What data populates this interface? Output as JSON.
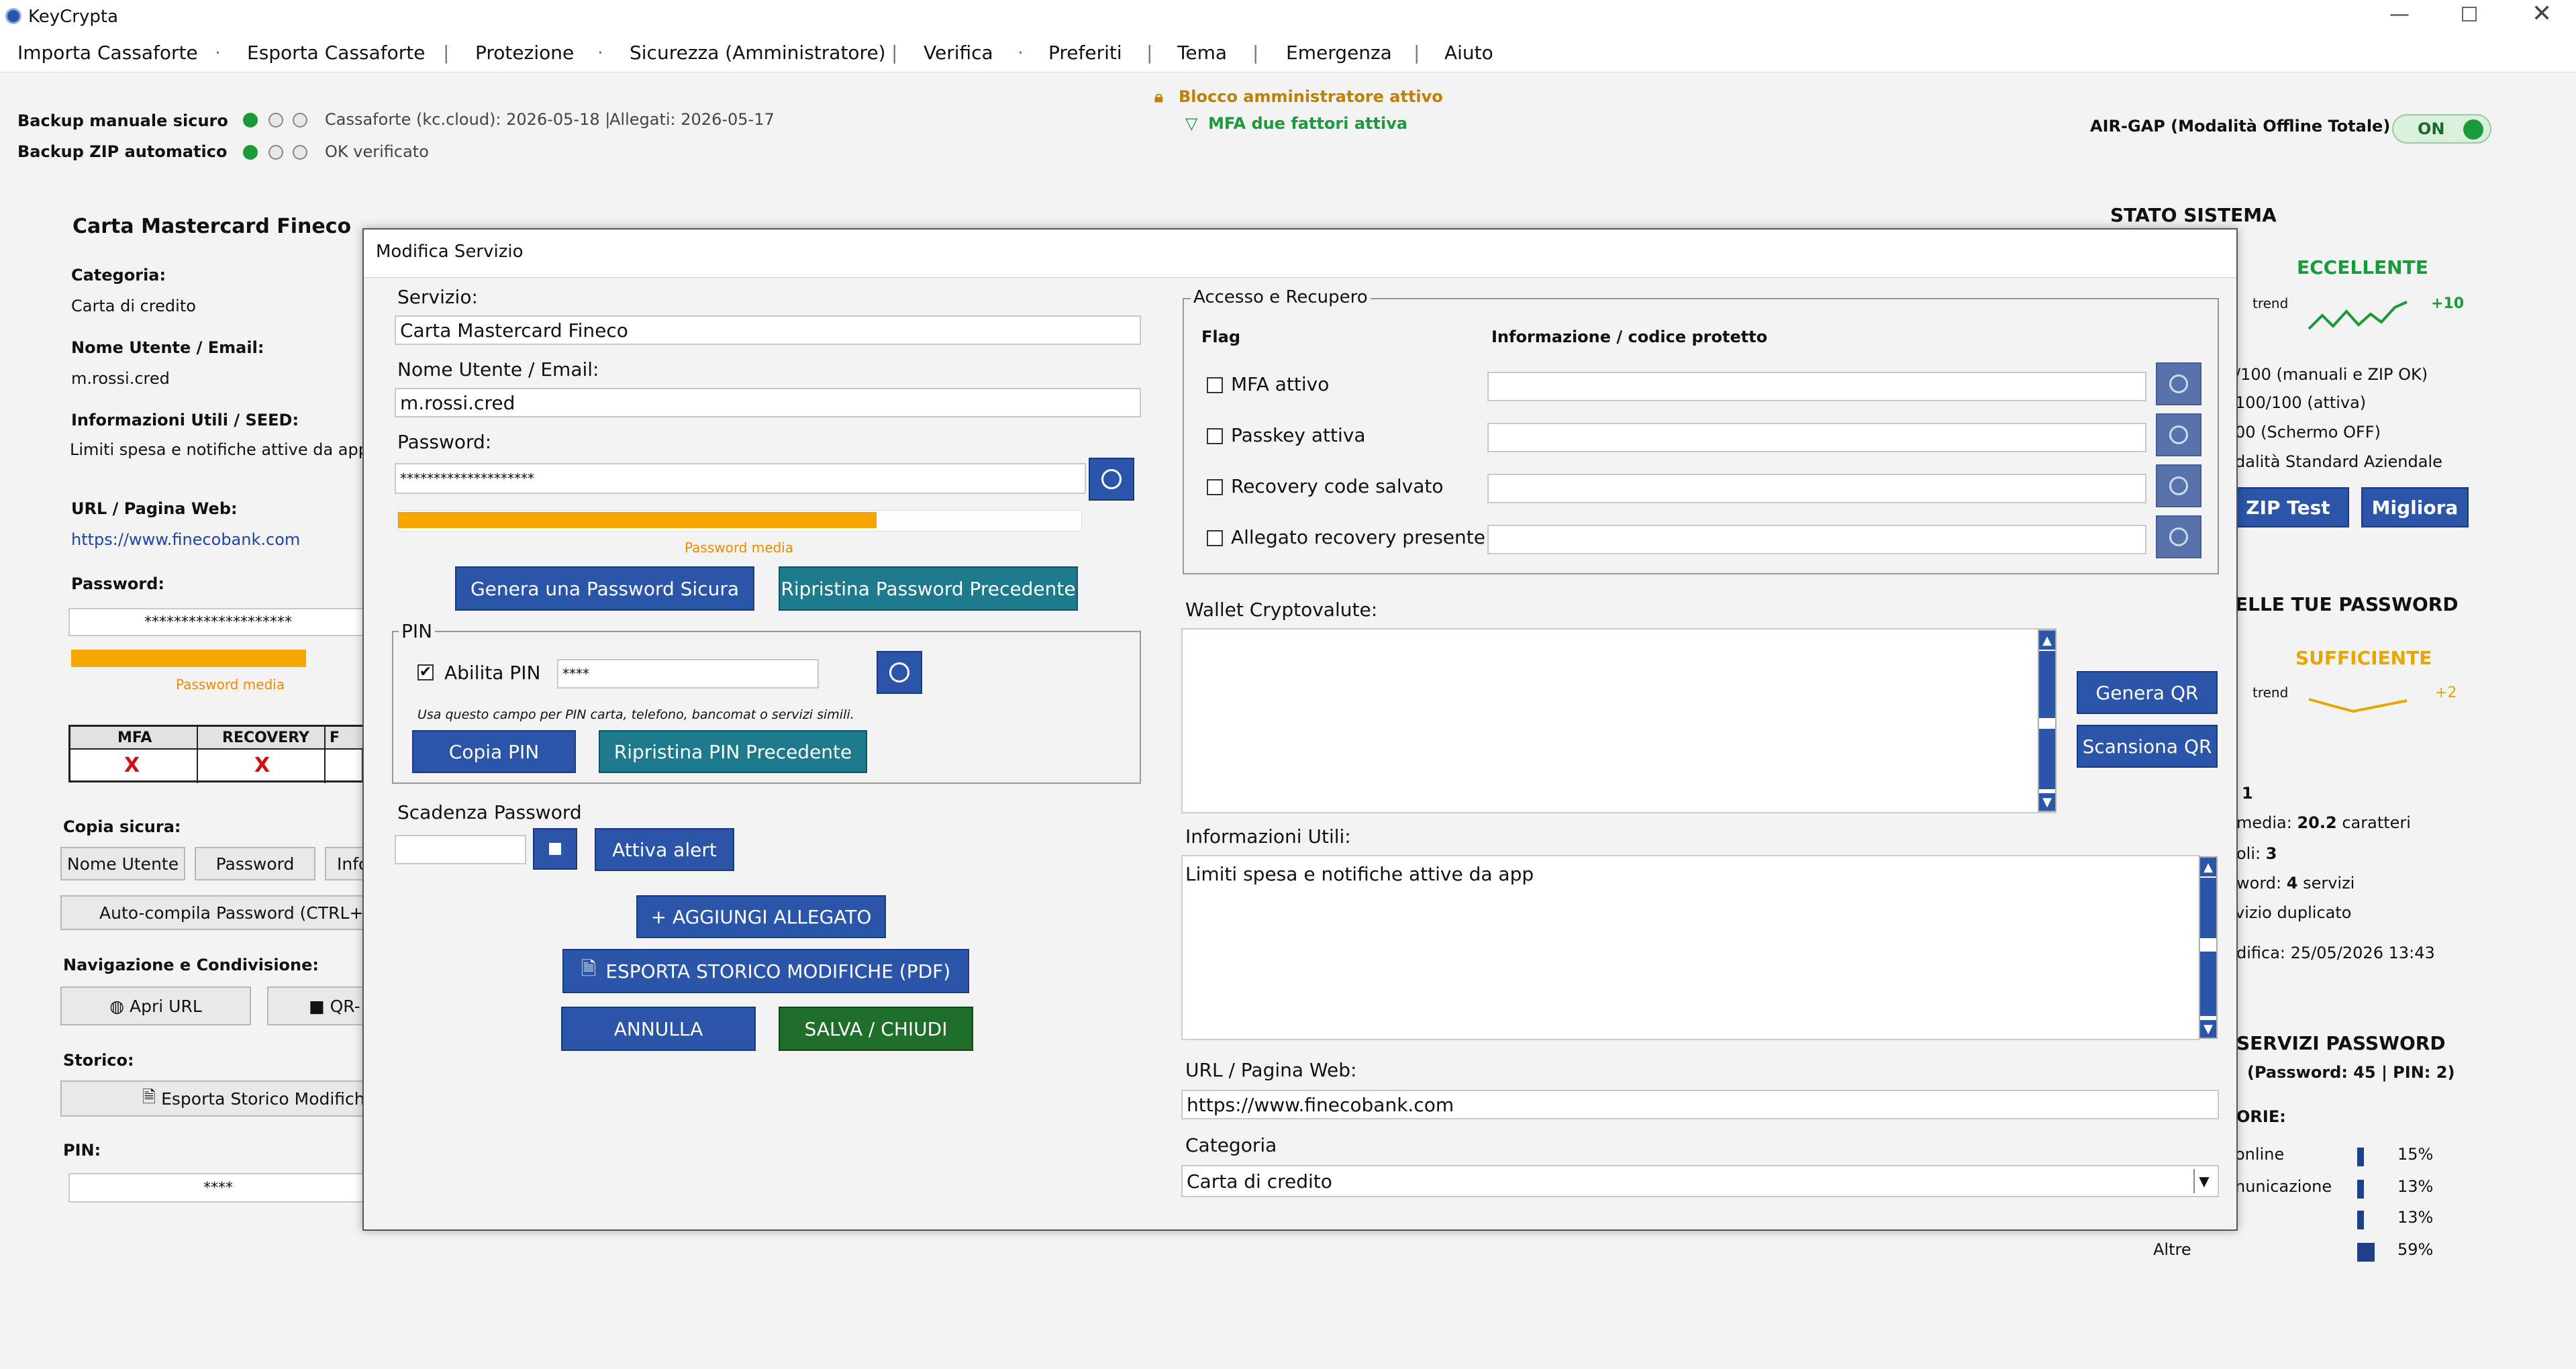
{
  "window": {
    "title": "KeyCrypta"
  },
  "menu": [
    "Importa Cassaforte",
    "Esporta Cassaforte",
    "Protezione",
    "Sicurezza (Amministratore)",
    "Verifica",
    "Preferiti",
    "Tema",
    "Emergenza",
    "Aiuto"
  ],
  "status": {
    "backup_manual_label": "Backup manuale sicuro",
    "backup_manual_info": "Cassaforte (kc.cloud): 2026-05-18 |",
    "backup_manual_attach": "Allegati: 2026-05-17",
    "backup_zip_label": "Backup ZIP automatico",
    "backup_zip_info": "OK verificato",
    "admin_lock": "Blocco amministratore attivo",
    "mfa_active": "MFA due fattori attiva",
    "airgap_label": "AIR-GAP (Modalità Offline Totale)",
    "airgap_toggle": "ON",
    "colors": {
      "green": "#1a9a3a",
      "orange": "#c08000",
      "accent": "#2b55a8"
    }
  },
  "left_panel": {
    "title": "Carta Mastercard Fineco",
    "category_label": "Categoria:",
    "category_value": "Carta di credito",
    "user_label": "Nome Utente / Email:",
    "user_value": "m.rossi.cred",
    "info_label": "Informazioni Utili / SEED:",
    "info_value": "Limiti spesa e notifiche attive da app",
    "url_label": "URL / Pagina Web:",
    "url_value": "https://www.finecobank.com",
    "password_label": "Password:",
    "password_value": "********************",
    "strength_text": "Password media",
    "flags_headers": [
      "MFA",
      "RECOVERY",
      "F"
    ],
    "flags_values": [
      "X",
      "X",
      ""
    ],
    "copy_label": "Copia sicura:",
    "copy_buttons": [
      "Nome Utente",
      "Password",
      "Info"
    ],
    "autofill": "Auto-compila Password (CTRL+A",
    "nav_label": "Navigazione e Condivisione:",
    "open_url": "Apri URL",
    "qr": "QR-",
    "history_label": "Storico:",
    "export_history": "Esporta Storico Modifich",
    "pin_label": "PIN:",
    "pin_value": "****"
  },
  "right_panel": {
    "title": "STATO SISTEMA",
    "rating": "ECCELLENTE",
    "trend_label": "trend",
    "trend_delta": "+10",
    "lines": [
      "/100 (manuali e ZIP OK)",
      "100/100 (attiva)",
      "00 (Schermo OFF)",
      "dalità Standard Aziendale"
    ],
    "zip_test": "ZIP Test",
    "improve": "Migliora",
    "pw_title": "ELLE TUE PASSWORD",
    "pw_rating": "SUFFICIENTE",
    "pw_trend": "trend",
    "pw_delta": "+2",
    "stat_1": "1",
    "stat_avg_prefix": "media:",
    "stat_avg_value": "20.2",
    "stat_avg_suffix": "caratteri",
    "stat_soli_prefix": "oli:",
    "stat_soli_value": "3",
    "stat_word_prefix": "word:",
    "stat_word_value": "4",
    "stat_word_suffix": "servizi",
    "stat_dup": "vizio duplicato",
    "stat_mod": "difica: 25/05/2026 13:43",
    "services_title": "SERVIZI PASSWORD",
    "services_sub": "(Password: 45 | PIN: 2)",
    "cat_title": "ORIE:",
    "categories": [
      {
        "label": "online",
        "pct": "15%",
        "value": 15
      },
      {
        "label": "nunicazione",
        "pct": "13%",
        "value": 13
      },
      {
        "label": "",
        "pct": "13%",
        "value": 13
      },
      {
        "label": "Altre",
        "pct": "59%",
        "value": 59
      }
    ]
  },
  "dialog": {
    "title": "Modifica Servizio",
    "service_label": "Servizio:",
    "service_value": "Carta Mastercard Fineco",
    "user_label": "Nome Utente / Email:",
    "user_value": "m.rossi.cred",
    "password_label": "Password:",
    "password_value": "********************",
    "strength_text": "Password media",
    "strength": 0.7,
    "gen_password": "Genera una Password Sicura",
    "restore_password": "Ripristina Password Precedente",
    "pin_group": "PIN",
    "enable_pin": "Abilita PIN",
    "pin_value": "****",
    "pin_hint": "Usa questo campo per PIN carta, telefono, bancomat o servizi simili.",
    "copy_pin": "Copia PIN",
    "restore_pin": "Ripristina PIN Precedente",
    "expiry_label": "Scadenza Password",
    "expiry_value": "",
    "alert_btn": "Attiva alert",
    "add_attachment": "+ AGGIUNGI ALLEGATO",
    "export_history": "ESPORTA STORICO MODIFICHE (PDF)",
    "cancel": "ANNULLA",
    "save": "SALVA / CHIUDI",
    "access_group": "Accesso e Recupero",
    "flag_col": "Flag",
    "info_col": "Informazione / codice protetto",
    "flags": [
      "MFA attivo",
      "Passkey attiva",
      "Recovery code salvato",
      "Allegato recovery presente"
    ],
    "wallet_label": "Wallet Cryptovalute:",
    "gen_qr": "Genera QR",
    "scan_qr": "Scansiona QR",
    "info_label": "Informazioni Utili:",
    "info_value": "Limiti spesa e notifiche attive da app",
    "url_label": "URL / Pagina Web:",
    "url_value": "https://www.finecobank.com",
    "category_label": "Categoria",
    "category_value": "Carta di credito"
  }
}
